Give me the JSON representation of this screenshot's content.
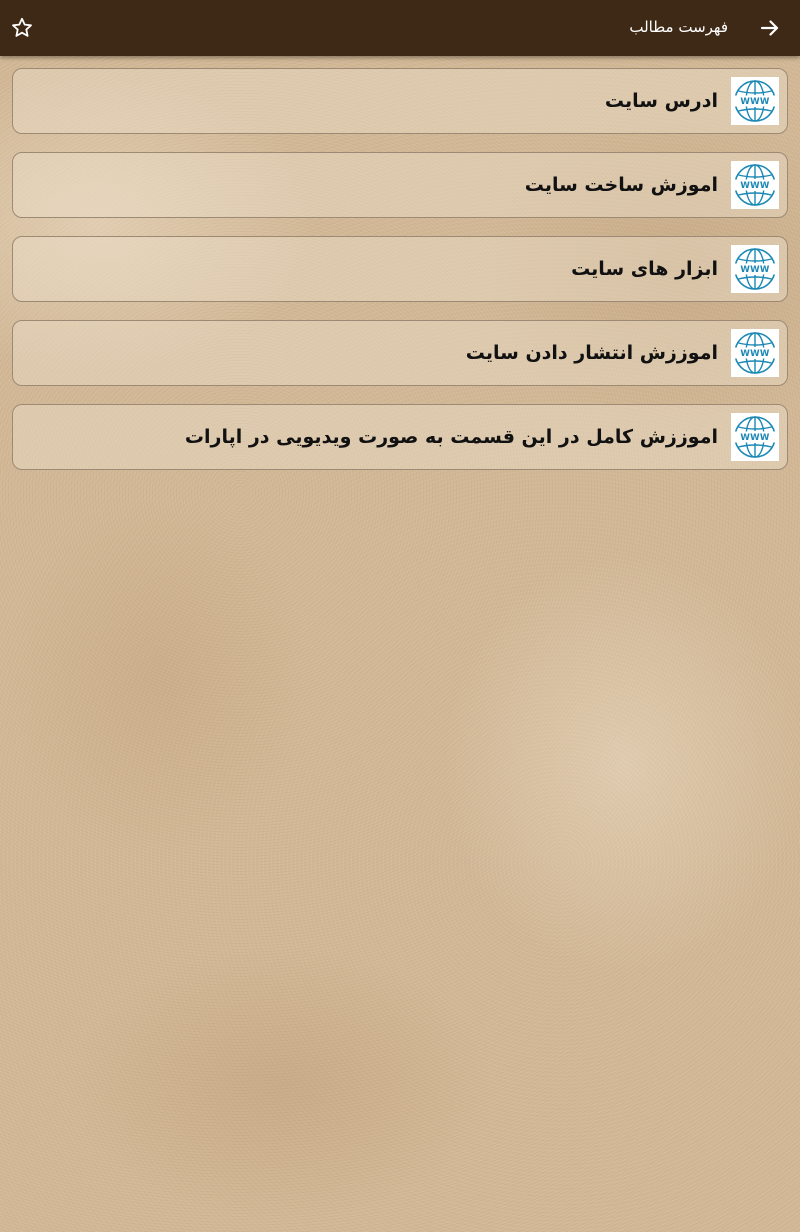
{
  "header": {
    "title": "فهرست مطالب",
    "back_icon": "arrow-right-icon",
    "favorite_icon": "star-outline-icon"
  },
  "items": [
    {
      "label": "ادرس سایت",
      "icon": "www-globe-icon"
    },
    {
      "label": "اموزش ساخت سایت",
      "icon": "www-globe-icon"
    },
    {
      "label": "ابزار های سایت",
      "icon": "www-globe-icon"
    },
    {
      "label": "اموززش انتشار دادن سایت",
      "icon": "www-globe-icon"
    },
    {
      "label": "اموززش کامل در این قسمت به صورت ویدیویی در اپارات",
      "icon": "www-globe-icon"
    }
  ],
  "colors": {
    "appbar": "#3e2916",
    "background": "#d2b896",
    "globe": "#1b88b5",
    "item_border": "#9d8a74"
  }
}
